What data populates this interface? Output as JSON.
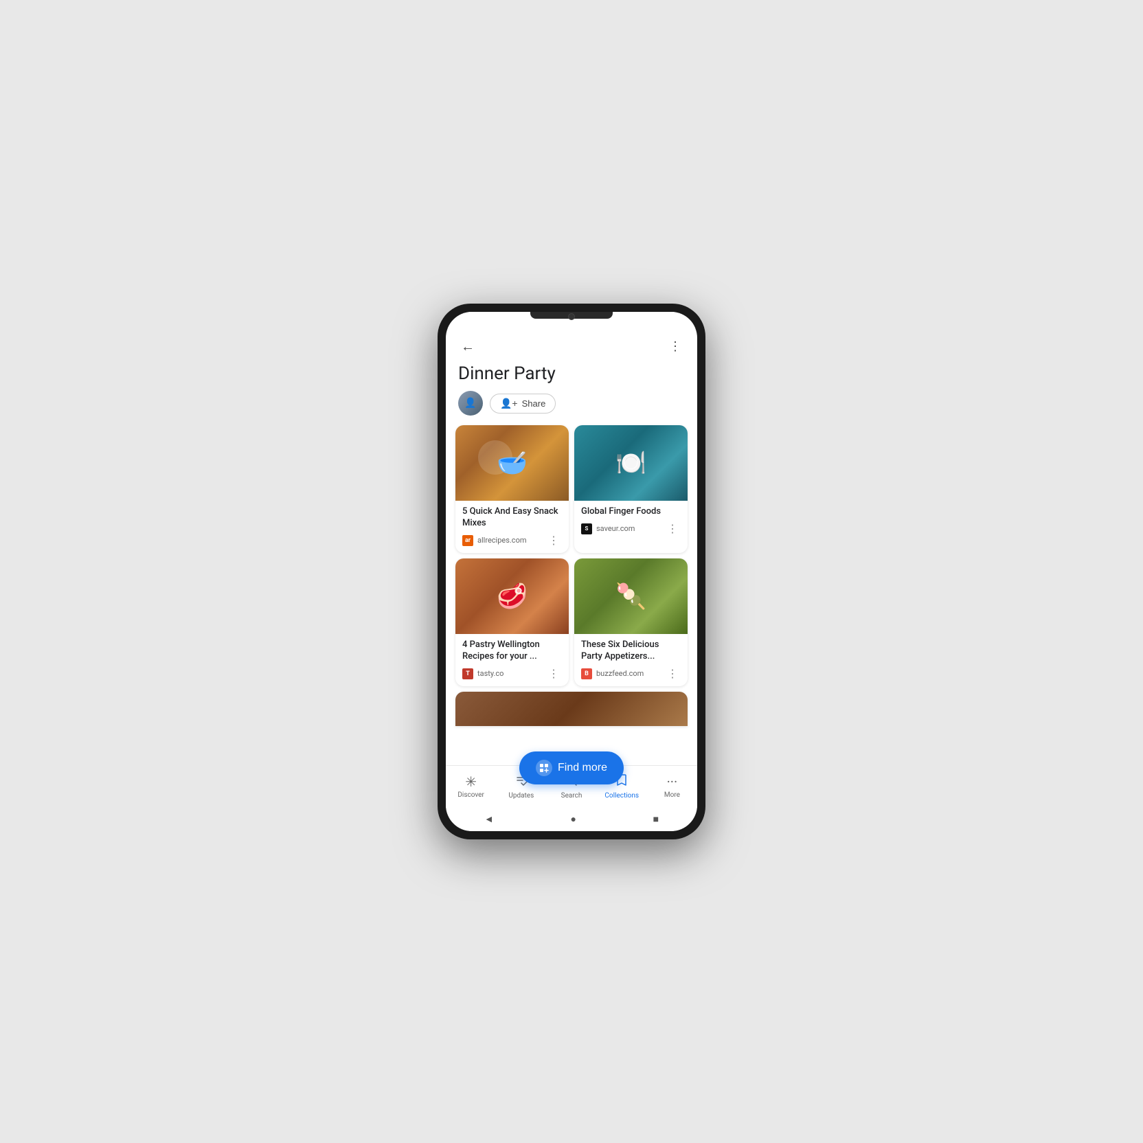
{
  "phone": {
    "status_bar": ""
  },
  "header": {
    "back_label": "←",
    "more_label": "⋮",
    "title": "Dinner Party"
  },
  "user": {
    "share_label": "Share"
  },
  "cards": [
    {
      "id": "snack-mixes",
      "title": "5 Quick And Easy Snack Mixes",
      "source": "allrecipes.com",
      "source_letter": "ar",
      "source_class": "source-allrecipes",
      "img_class": "img-snack"
    },
    {
      "id": "finger-foods",
      "title": "Global Finger Foods",
      "source": "saveur.com",
      "source_letter": "S",
      "source_class": "source-saveur",
      "img_class": "img-finger"
    },
    {
      "id": "wellington",
      "title": "4 Pastry Wellington Recipes for your ...",
      "source": "tasty.co",
      "source_letter": "T",
      "source_class": "source-tasty",
      "img_class": "img-wellington"
    },
    {
      "id": "appetizers",
      "title": "These Six Delicious Party Appetizers...",
      "source": "buzzfeed.com",
      "source_letter": "B",
      "source_class": "source-buzzfeed",
      "img_class": "img-appetizer"
    }
  ],
  "find_more": {
    "label": "Find more"
  },
  "bottom_nav": {
    "items": [
      {
        "id": "discover",
        "icon": "✳",
        "label": "Discover",
        "active": false
      },
      {
        "id": "updates",
        "icon": "⬇",
        "label": "Updates",
        "active": false
      },
      {
        "id": "search",
        "icon": "🔍",
        "label": "Search",
        "active": false
      },
      {
        "id": "collections",
        "icon": "🔖",
        "label": "Collections",
        "active": true
      },
      {
        "id": "more",
        "icon": "···",
        "label": "More",
        "active": false
      }
    ]
  },
  "system_nav": {
    "back": "◄",
    "home": "●",
    "recents": "■"
  }
}
